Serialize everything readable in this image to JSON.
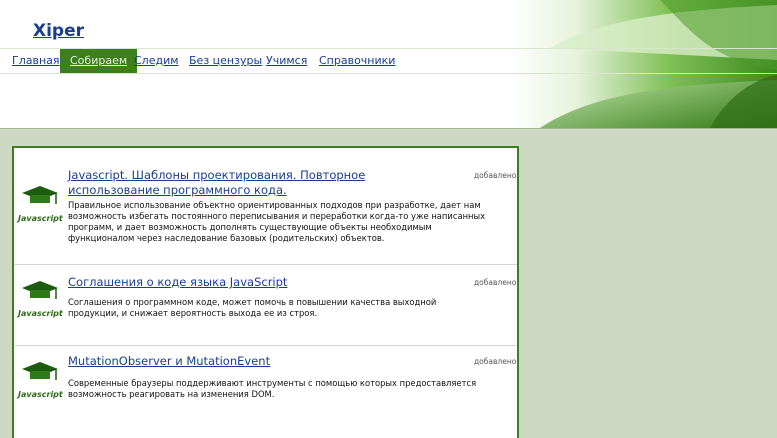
{
  "site": {
    "logo": "Xiper"
  },
  "nav": {
    "items": [
      {
        "label": "Главная"
      },
      {
        "label": "Собираем"
      },
      {
        "label": "Следим"
      },
      {
        "label": "Без цензуры"
      },
      {
        "label": "Учимся"
      },
      {
        "label": "Справочники"
      }
    ],
    "active_index": 1
  },
  "colors": {
    "accent": "#3d7e1e",
    "link": "#1a3d8f",
    "page_bg": "#cdd9c2"
  },
  "articles": [
    {
      "icon": "javascript-logo-icon",
      "icon_caption": "Javascript",
      "title": "Javascript. Шаблоны проектирования. Повторное использование программного кода.",
      "added": "добавлено",
      "description": "Правильное использование объектно ориентированных подходов при разработке, дает нам возможность избегать постоянного переписывания и переработки когда-то уже написанных программ, и дает возможность дополнять существующие объекты необходимым функционалом через наследование базовых (родительских) объектов."
    },
    {
      "icon": "javascript-logo-icon",
      "icon_caption": "Javascript",
      "title": "Соглашения о коде языка JavaScript",
      "added": "добавлено",
      "description": "Соглашения о программном коде, может помочь в повышении качества выходной продукции, и снижает вероятность выхода ее из строя."
    },
    {
      "icon": "javascript-logo-icon",
      "icon_caption": "Javascript",
      "title": "MutationObserver и MutationEvent",
      "added": "добавлено",
      "description": "Современные браузеры поддерживают инструменты с помощью которых предоставляется возможность реагировать на изменения DOM."
    }
  ]
}
